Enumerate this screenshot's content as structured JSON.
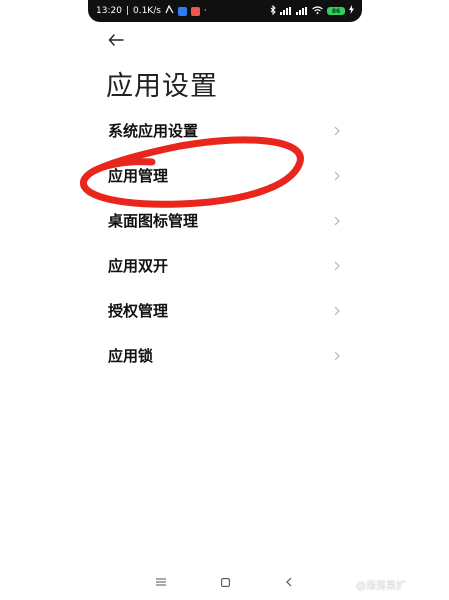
{
  "status_bar": {
    "time": "13:20",
    "net_speed": "0.1K/s",
    "battery": "86"
  },
  "header": {
    "title": "应用设置"
  },
  "menu": {
    "items": [
      {
        "label": "系统应用设置"
      },
      {
        "label": "应用管理"
      },
      {
        "label": "桌面图标管理"
      },
      {
        "label": "应用双开"
      },
      {
        "label": "授权管理"
      },
      {
        "label": "应用锁"
      }
    ]
  },
  "watermark": "@渐落黑扩",
  "colors": {
    "status_bar_bg": "#101010",
    "annotation_red": "#e8261c",
    "chevron": "#bdbdbd",
    "battery": "#2fd15a"
  }
}
